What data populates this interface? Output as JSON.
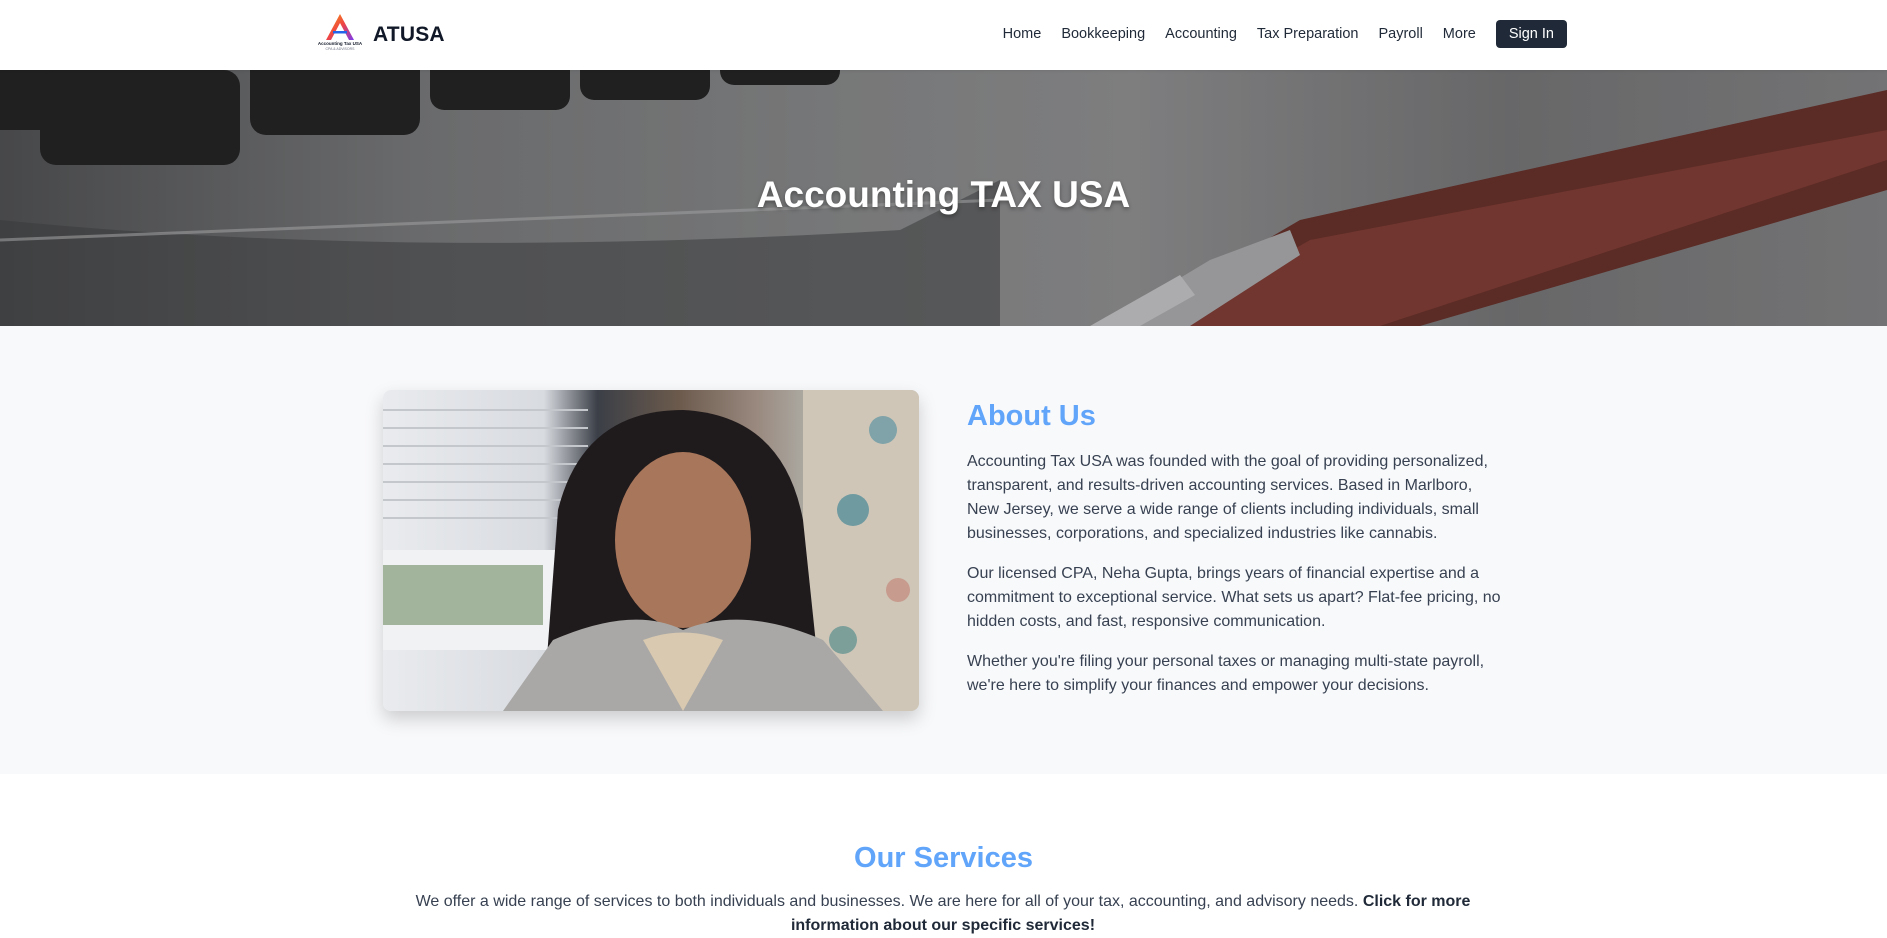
{
  "nav": {
    "logo_text": "Accounting Tax USA",
    "logo_subtext": "CPA & ADVISORS",
    "brand": "ATUSA",
    "links": [
      "Home",
      "Bookkeeping",
      "Accounting",
      "Tax Preparation",
      "Payroll",
      "More"
    ],
    "signin_label": "Sign In"
  },
  "hero": {
    "title": "Accounting TAX USA"
  },
  "about": {
    "title": "About Us",
    "paragraphs": [
      "Accounting Tax USA was founded with the goal of providing personalized, transparent, and results-driven accounting services. Based in Marlboro, New Jersey, we serve a wide range of clients including individuals, small businesses, corporations, and specialized industries like cannabis.",
      "Our licensed CPA, Neha Gupta, brings years of financial expertise and a commitment to exceptional service. What sets us apart? Flat-fee pricing, no hidden costs, and fast, responsive communication.",
      "Whether you're filing your personal taxes or managing multi-state payroll, we're here to simplify your finances and empower your decisions."
    ]
  },
  "services": {
    "title": "Our Services",
    "description": "We offer a wide range of services to both individuals and businesses. We are here for all of your tax, accounting, and advisory needs.",
    "cta": "Click for more information about our specific services!"
  },
  "colors": {
    "accent": "#60a5fa",
    "button_dark": "#1f2937",
    "about_bg": "#f8f9fb"
  }
}
